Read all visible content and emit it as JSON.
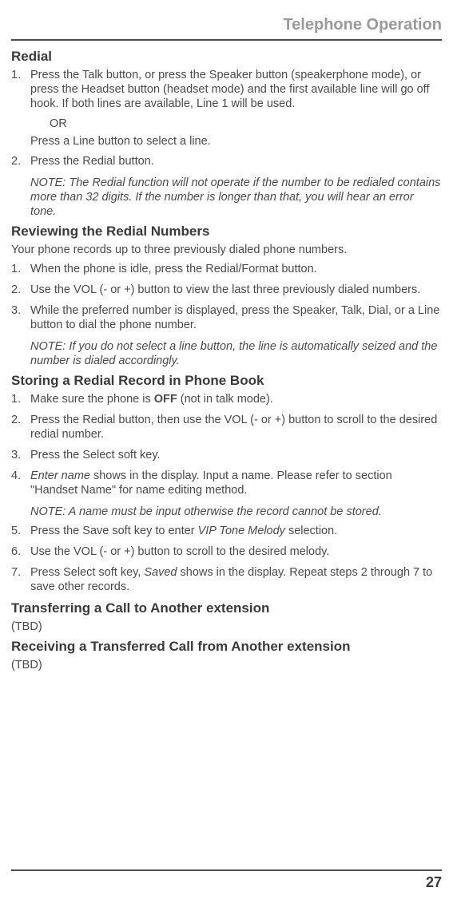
{
  "header": "Telephone Operation",
  "sections": {
    "redial": {
      "heading": "Redial",
      "step1": "Press the Talk button, or press the Speaker button (speakerphone mode), or press the Headset button (headset mode) and the first available line will go off hook. If both lines are available, Line 1 will be used.",
      "or": " OR",
      "or_line": "Press a Line button to select a line.",
      "step2": "Press the Redial button.",
      "note": "NOTE: The Redial function will not operate if the number to be redialed contains more than 32 digits. If the number is longer than that, you will hear an error tone."
    },
    "reviewing": {
      "heading": "Reviewing the Redial Numbers",
      "intro": "Your phone records up to three previously dialed phone numbers.",
      "step1": "When the phone is idle, press the Redial/Format button.",
      "step2": "Use the VOL (- or +) button to view the last three previously dialed numbers.",
      "step3": "While the preferred number is displayed, press the Speaker, Talk, Dial, or a Line button to dial the phone number.",
      "note": "NOTE: If you do not select a line button, the line is automatically seized and the number is dialed accordingly."
    },
    "storing": {
      "heading": "Storing a Redial Record in Phone Book",
      "step1_a": "Make sure the phone is ",
      "step1_b": "OFF",
      "step1_c": " (not in talk mode).",
      "step2": "Press the Redial button, then use the VOL (- or +) button to scroll to the desired redial number.",
      "step3": "Press the Select soft key.",
      "step4_a": "Enter name",
      "step4_b": " shows in the display. Input a name. Please refer to section \"Handset Name\" for name editing method.",
      "note": "NOTE: A name must be input otherwise the record cannot be stored.",
      "step5_a": "Press the Save soft key to enter ",
      "step5_b": "VIP Tone Melody",
      "step5_c": " selection.",
      "step6": "Use the VOL (- or +) button to scroll to the desired melody.",
      "step7_a": "Press Select soft key, ",
      "step7_b": "Saved",
      "step7_c": " shows in the display. Repeat steps 2 through 7 to save other records."
    },
    "transferring": {
      "heading": "Transferring a Call to Another extension",
      "body": "(TBD)"
    },
    "receiving": {
      "heading": "Receiving a Transferred Call from Another extension",
      "body": "(TBD)"
    }
  },
  "page_number": "27"
}
